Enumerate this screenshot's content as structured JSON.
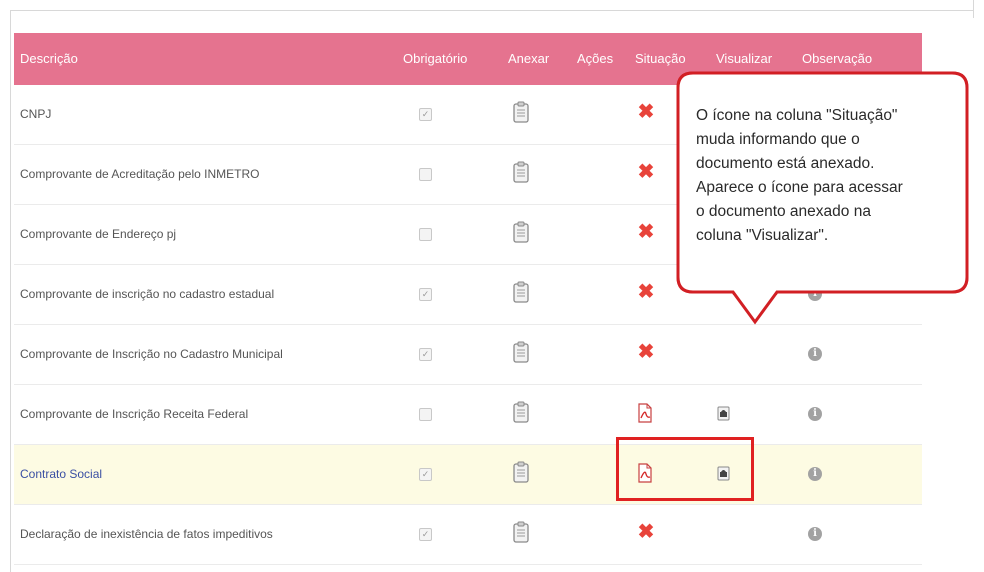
{
  "table": {
    "headers": [
      "Descrição",
      "Obrigatório",
      "Anexar",
      "Ações",
      "Situação",
      "Visualizar",
      "Observação"
    ],
    "rows": [
      {
        "description": "CNPJ",
        "required": true,
        "status": "pending"
      },
      {
        "description": "Comprovante de Acreditação pelo INMETRO",
        "required": false,
        "status": "pending"
      },
      {
        "description": "Comprovante de Endereço pj",
        "required": false,
        "status": "pending"
      },
      {
        "description": "Comprovante de inscrição no cadastro estadual",
        "required": true,
        "status": "pending"
      },
      {
        "description": "Comprovante de Inscrição no Cadastro Municipal",
        "required": true,
        "status": "pending"
      },
      {
        "description": "Comprovante de Inscrição Receita Federal",
        "required": false,
        "status": "attached"
      },
      {
        "description": "Contrato Social",
        "required": true,
        "status": "attached"
      },
      {
        "description": "Declaração de inexistência de fatos impeditivos",
        "required": true,
        "status": "pending"
      }
    ]
  },
  "callout": {
    "lines": [
      "O ícone na coluna \"Situação\"",
      "muda informando que o",
      "documento está anexado.",
      "Aparece o ícone para acessar",
      "o documento anexado na",
      "coluna \"Visualizar\"."
    ]
  },
  "icons": {
    "attach": "clipboard-icon",
    "pending": "red-x-icon",
    "attached": "pdf-icon",
    "view": "view-document-icon",
    "observation": "info-icon"
  },
  "colors": {
    "header_bg": "#e5738f",
    "highlight_row": "#fdfbe3",
    "alert_red": "#e02121"
  }
}
